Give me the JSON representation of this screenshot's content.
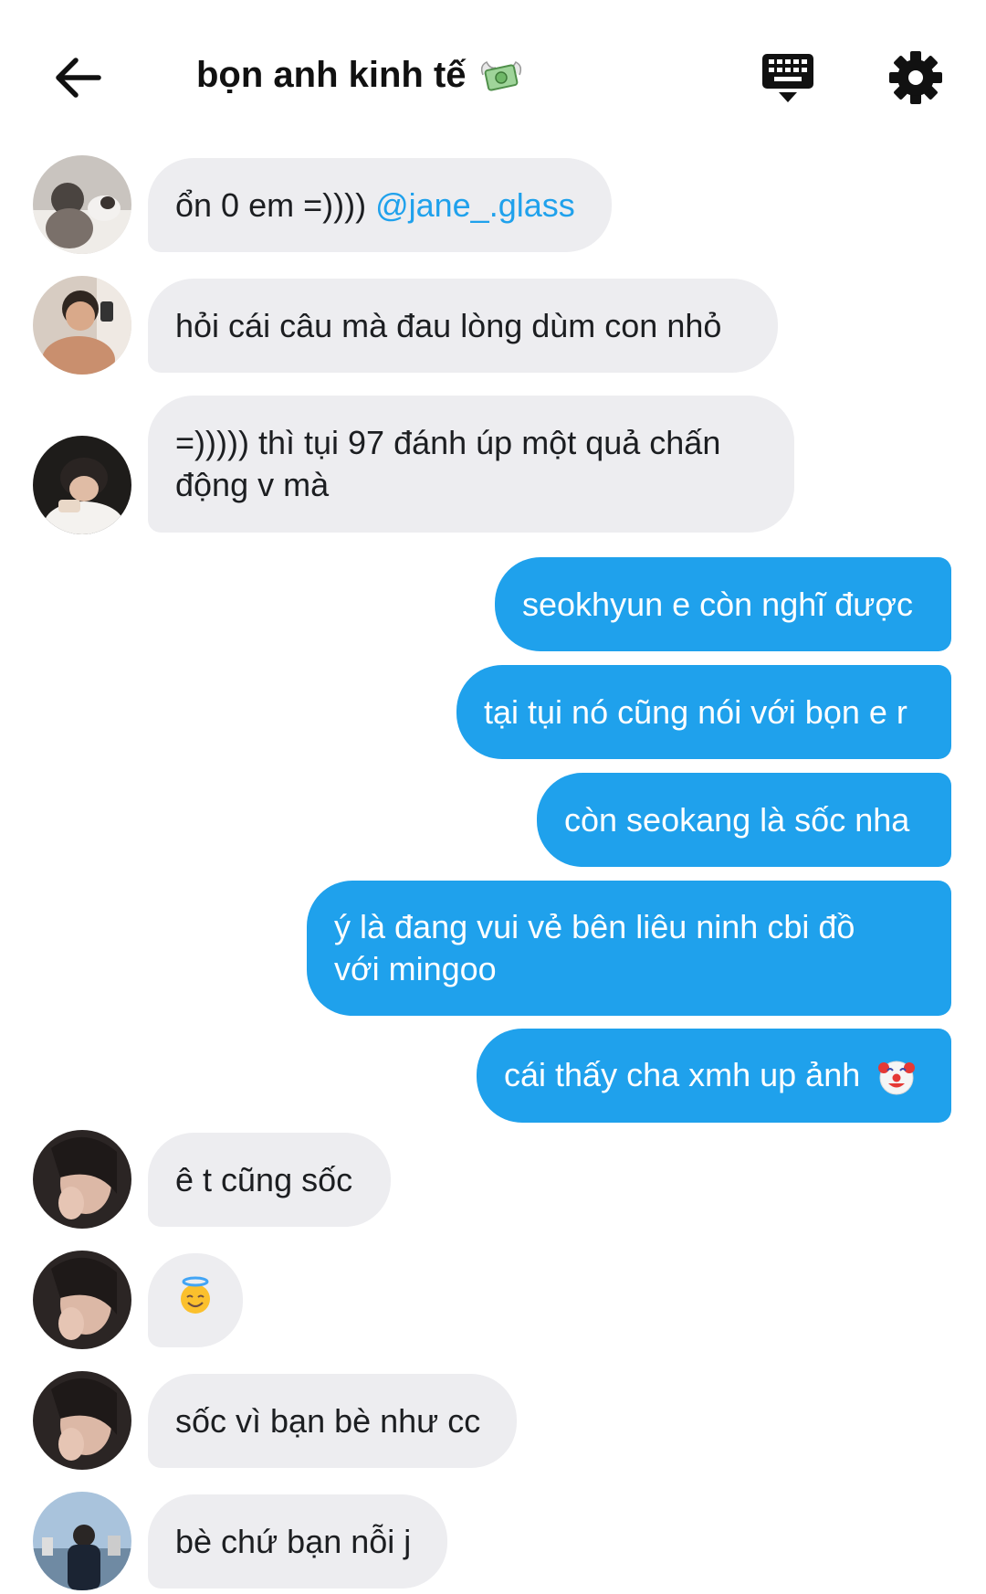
{
  "header": {
    "title": "bọn anh kinh tế",
    "title_emoji": "money-with-wings-emoji",
    "icons": {
      "back": "arrow-left-icon",
      "keyboard": "keyboard-icon",
      "settings": "gear-icon"
    }
  },
  "colors": {
    "outgoing_bubble": "#1fa1ec",
    "incoming_bubble": "#ededf0",
    "mention": "#1fa1ec"
  },
  "messages": [
    {
      "dir": "in",
      "text": "ổn 0 em =))))",
      "mention": "@jane_.glass"
    },
    {
      "dir": "in",
      "text": "hỏi cái câu mà đau lòng dùm con nhỏ"
    },
    {
      "dir": "in",
      "text": "=))))) thì tụi 97 đánh úp một quả chấn động v mà"
    },
    {
      "dir": "out",
      "text": "seokhyun e còn nghĩ được"
    },
    {
      "dir": "out",
      "text": "tại tụi nó cũng nói với bọn e r"
    },
    {
      "dir": "out",
      "text": "còn seokang là sốc nha"
    },
    {
      "dir": "out",
      "text": "ý là đang vui vẻ bên liêu ninh cbi đồ với mingoo"
    },
    {
      "dir": "out",
      "text": "cái thấy cha xmh up ảnh",
      "emoji": "clown-face-emoji"
    },
    {
      "dir": "in",
      "text": "ê t cũng sốc"
    },
    {
      "dir": "in",
      "emoji": "smiling-face-with-halo-emoji"
    },
    {
      "dir": "in",
      "text": "sốc vì bạn bè như cc"
    },
    {
      "dir": "in",
      "text": "bè chứ bạn nỗi j"
    }
  ]
}
